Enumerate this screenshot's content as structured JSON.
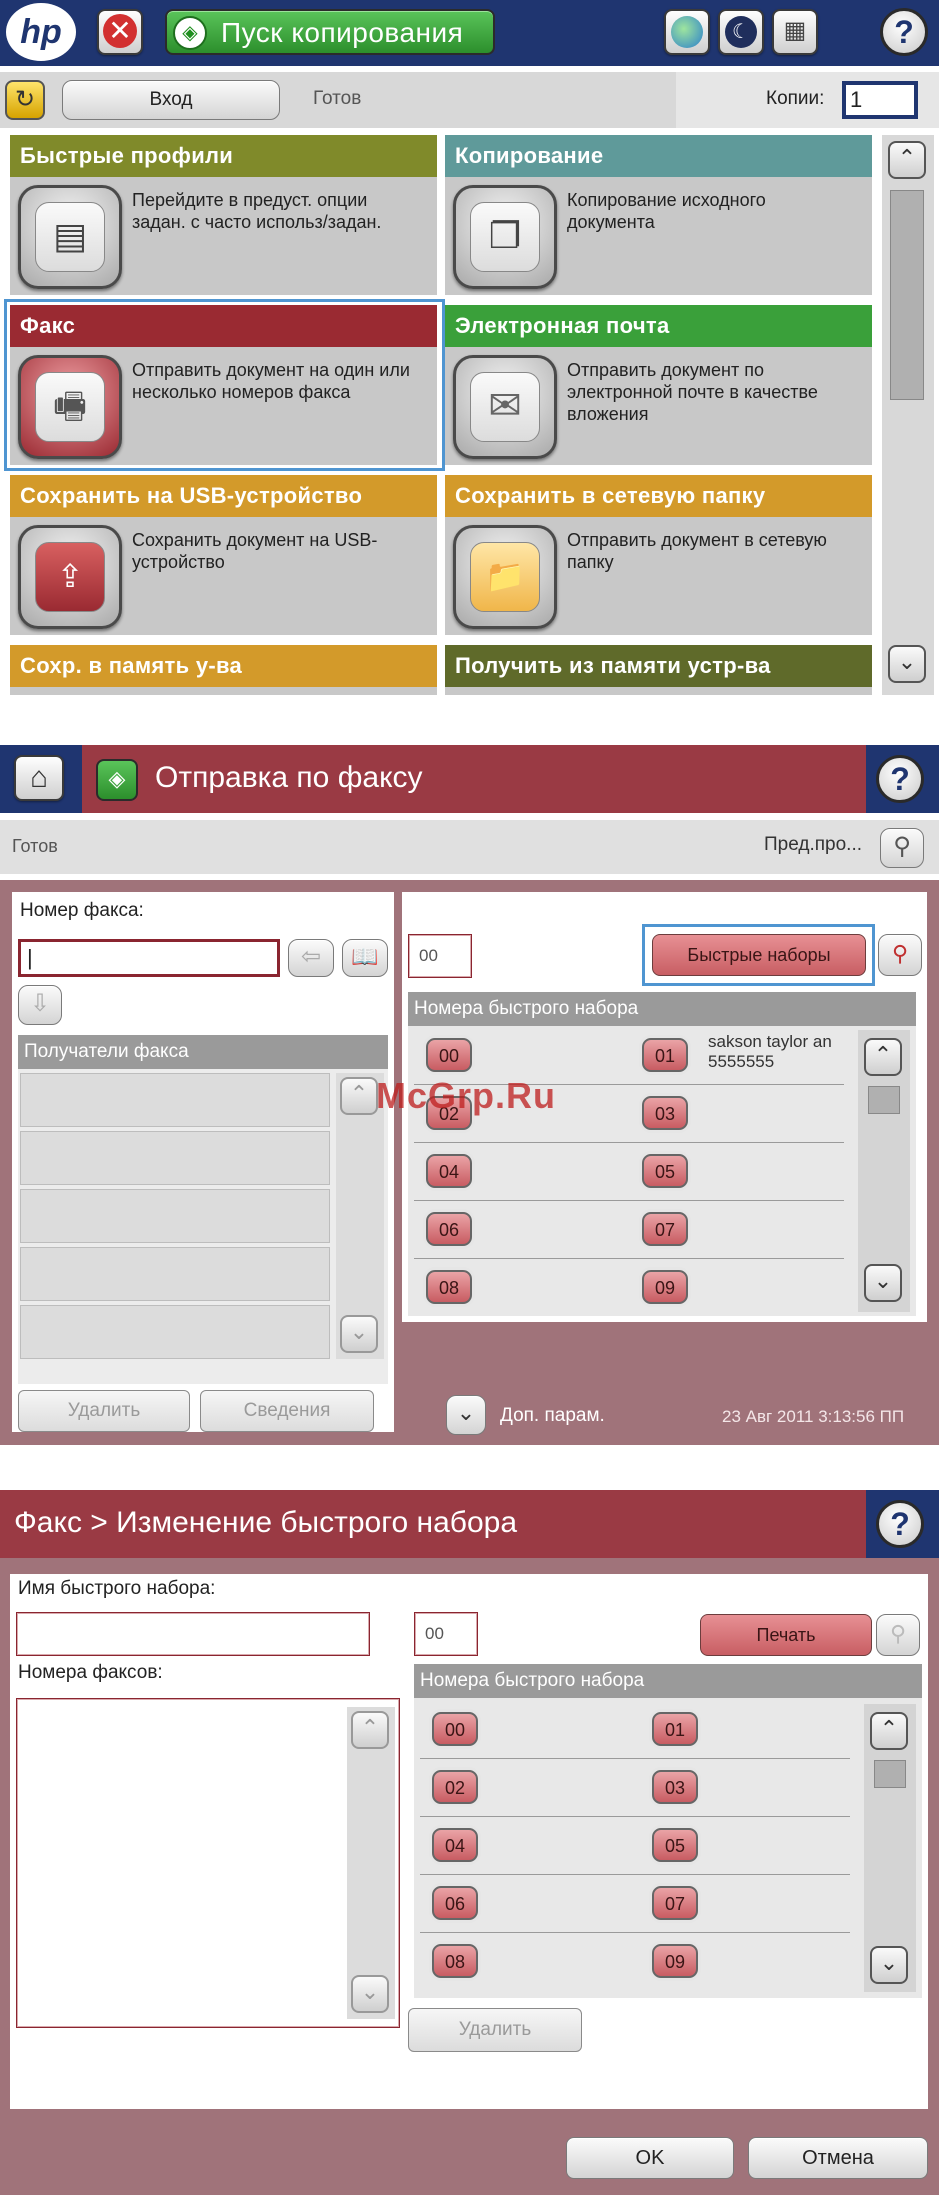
{
  "screen1": {
    "title": "Пуск копирования",
    "status": "Готов",
    "login_label": "Вход",
    "copies_label": "Копии:",
    "copies_value": "1",
    "tiles": [
      {
        "title": "Быстрые профили",
        "desc": "Перейдите в предуст. опции задан. с часто использ/задан.",
        "color": "#808a2a"
      },
      {
        "title": "Копирование",
        "desc": "Копирование исходного документа",
        "color": "#5f9a9a"
      },
      {
        "title": "Факс",
        "desc": "Отправить документ на один или несколько номеров факса",
        "color": "#9a2a32"
      },
      {
        "title": "Электронная почта",
        "desc": "Отправить документ по электронной почте в качестве вложения",
        "color": "#3aa03a"
      },
      {
        "title": "Сохранить на USB-устройство",
        "desc": "Сохранить документ на USB-устройство",
        "color": "#d39a2a"
      },
      {
        "title": "Сохранить в сетевую папку",
        "desc": "Отправить документ в сетевую папку",
        "color": "#d39a2a"
      },
      {
        "title": "Сохр. в память у-ва",
        "color": "#d39a2a"
      },
      {
        "title": "Получить из памяти устр-ва",
        "color": "#5f6a2a"
      }
    ]
  },
  "screen2": {
    "title": "Отправка по факсу",
    "status": "Готов",
    "preview_label": "Пред.про...",
    "fax_number_label": "Номер факса:",
    "fax_number_value": "|",
    "recipients_header": "Получатели факса",
    "delete_label": "Удалить",
    "details_label": "Сведения",
    "speed_dial_code": "00",
    "speed_dials_button": "Быстрые наборы",
    "speed_dial_header": "Номера быстрого набора",
    "speed_dial_01_name": "sakson taylor an",
    "speed_dial_01_number": "5555555",
    "slots": [
      "00",
      "01",
      "02",
      "03",
      "04",
      "05",
      "06",
      "07",
      "08",
      "09"
    ],
    "more_options": "Доп. парам.",
    "datetime": "23 Авг 2011 3:13:56 ПП"
  },
  "screen3": {
    "title": "Факс > Изменение быстрого набора",
    "name_label": "Имя быстрого набора:",
    "code_value": "00",
    "print_label": "Печать",
    "fax_numbers_label": "Номера факсов:",
    "speed_dial_header": "Номера быстрого набора",
    "slots": [
      "00",
      "01",
      "02",
      "03",
      "04",
      "05",
      "06",
      "07",
      "08",
      "09"
    ],
    "delete_label": "Удалить",
    "ok_label": "OK",
    "cancel_label": "Отмена"
  },
  "watermark": "McGrp.Ru"
}
